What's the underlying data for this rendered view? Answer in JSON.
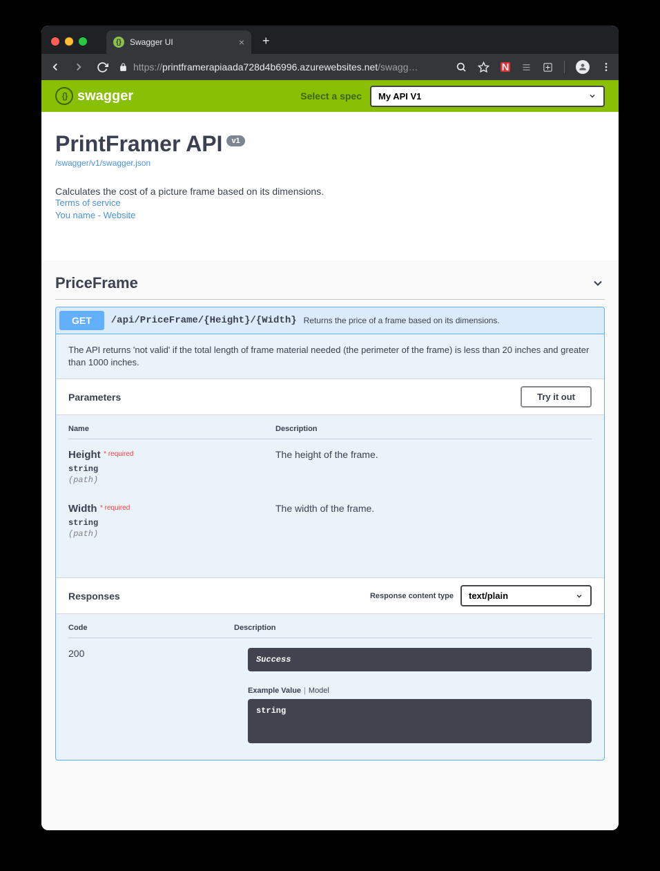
{
  "browser": {
    "tab_title": "Swagger UI",
    "url_host": "https://",
    "url_domain": "printframerapiaada728d4b6996.azurewebsites.net",
    "url_path": "/swagg…"
  },
  "swagger_header": {
    "logo_text": "swagger",
    "select_label": "Select a spec",
    "selected_spec": "My API V1"
  },
  "info": {
    "title": "PrintFramer API",
    "version": "v1",
    "spec_link": "/swagger/v1/swagger.json",
    "description": "Calculates the cost of a picture frame based on its dimensions.",
    "terms_link": "Terms of service",
    "contact_link": "You name - Website"
  },
  "tag": {
    "name": "PriceFrame"
  },
  "operation": {
    "method": "GET",
    "path": "/api/PriceFrame/{Height}/{Width}",
    "summary": "Returns the price of a frame based on its dimensions.",
    "note": "The API returns 'not valid' if the total length of frame material needed (the perimeter of the frame) is less than 20 inches and greater than 1000 inches.",
    "parameters_label": "Parameters",
    "try_label": "Try it out",
    "col_name": "Name",
    "col_desc": "Description",
    "params": [
      {
        "name": "Height",
        "required": "required",
        "type": "string",
        "in": "(path)",
        "desc": "The height of the frame."
      },
      {
        "name": "Width",
        "required": "required",
        "type": "string",
        "in": "(path)",
        "desc": "The width of the frame."
      }
    ],
    "responses_label": "Responses",
    "content_type_label": "Response content type",
    "content_type_value": "text/plain",
    "resp_col_code": "Code",
    "resp_col_desc": "Description",
    "response": {
      "code": "200",
      "desc": "Success",
      "example_label": "Example Value",
      "model_label": "Model",
      "example_body": "string"
    }
  }
}
